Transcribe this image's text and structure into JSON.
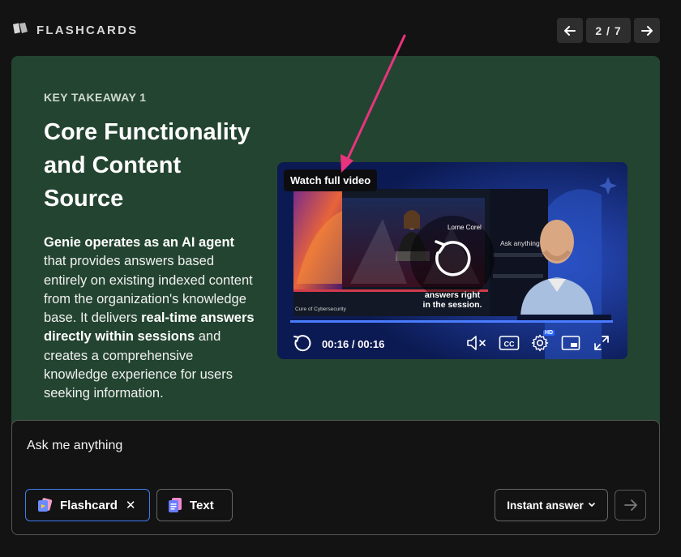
{
  "header": {
    "brand_title": "FLASHCARDS",
    "page_indicator": "2 / 7"
  },
  "card": {
    "kicker": "KEY TAKEAWAY 1",
    "title": "Core Functionality and Content Source",
    "body": {
      "b1": "Genie operates as an AI agent",
      "t1": " that provides answers based entirely on existing indexed content from the organization's knowledge base. It delivers ",
      "b2": "real-time answers directly within sessions",
      "t2": " and creates a comprehensive knowledge experience for users seeking information."
    },
    "background_color": "#234430"
  },
  "video": {
    "watch_label": "Watch full video",
    "caption_line1": "answers right",
    "caption_line2": "in the session.",
    "time": "00:16 / 00:16",
    "progress": 1.0,
    "hd_badge": "HD",
    "slide_speaker_name": "Lorne Corel",
    "slide_panel_title": "Ask anything",
    "slide_footer": "Cure of Cybersecurity",
    "icons": [
      "replay-icon",
      "mute-icon",
      "cc-icon",
      "settings-icon",
      "miniplayer-icon",
      "fullscreen-icon"
    ]
  },
  "composer": {
    "prompt": "Ask me anything",
    "chips": [
      {
        "label": "Flashcard",
        "close": "✕"
      },
      {
        "label": "Text"
      }
    ],
    "mode_label": "Instant answer"
  },
  "colors": {
    "accent_blue": "#3f7bf0",
    "annotation_pink": "#e8347d",
    "progress_blue": "#4a7cff"
  }
}
